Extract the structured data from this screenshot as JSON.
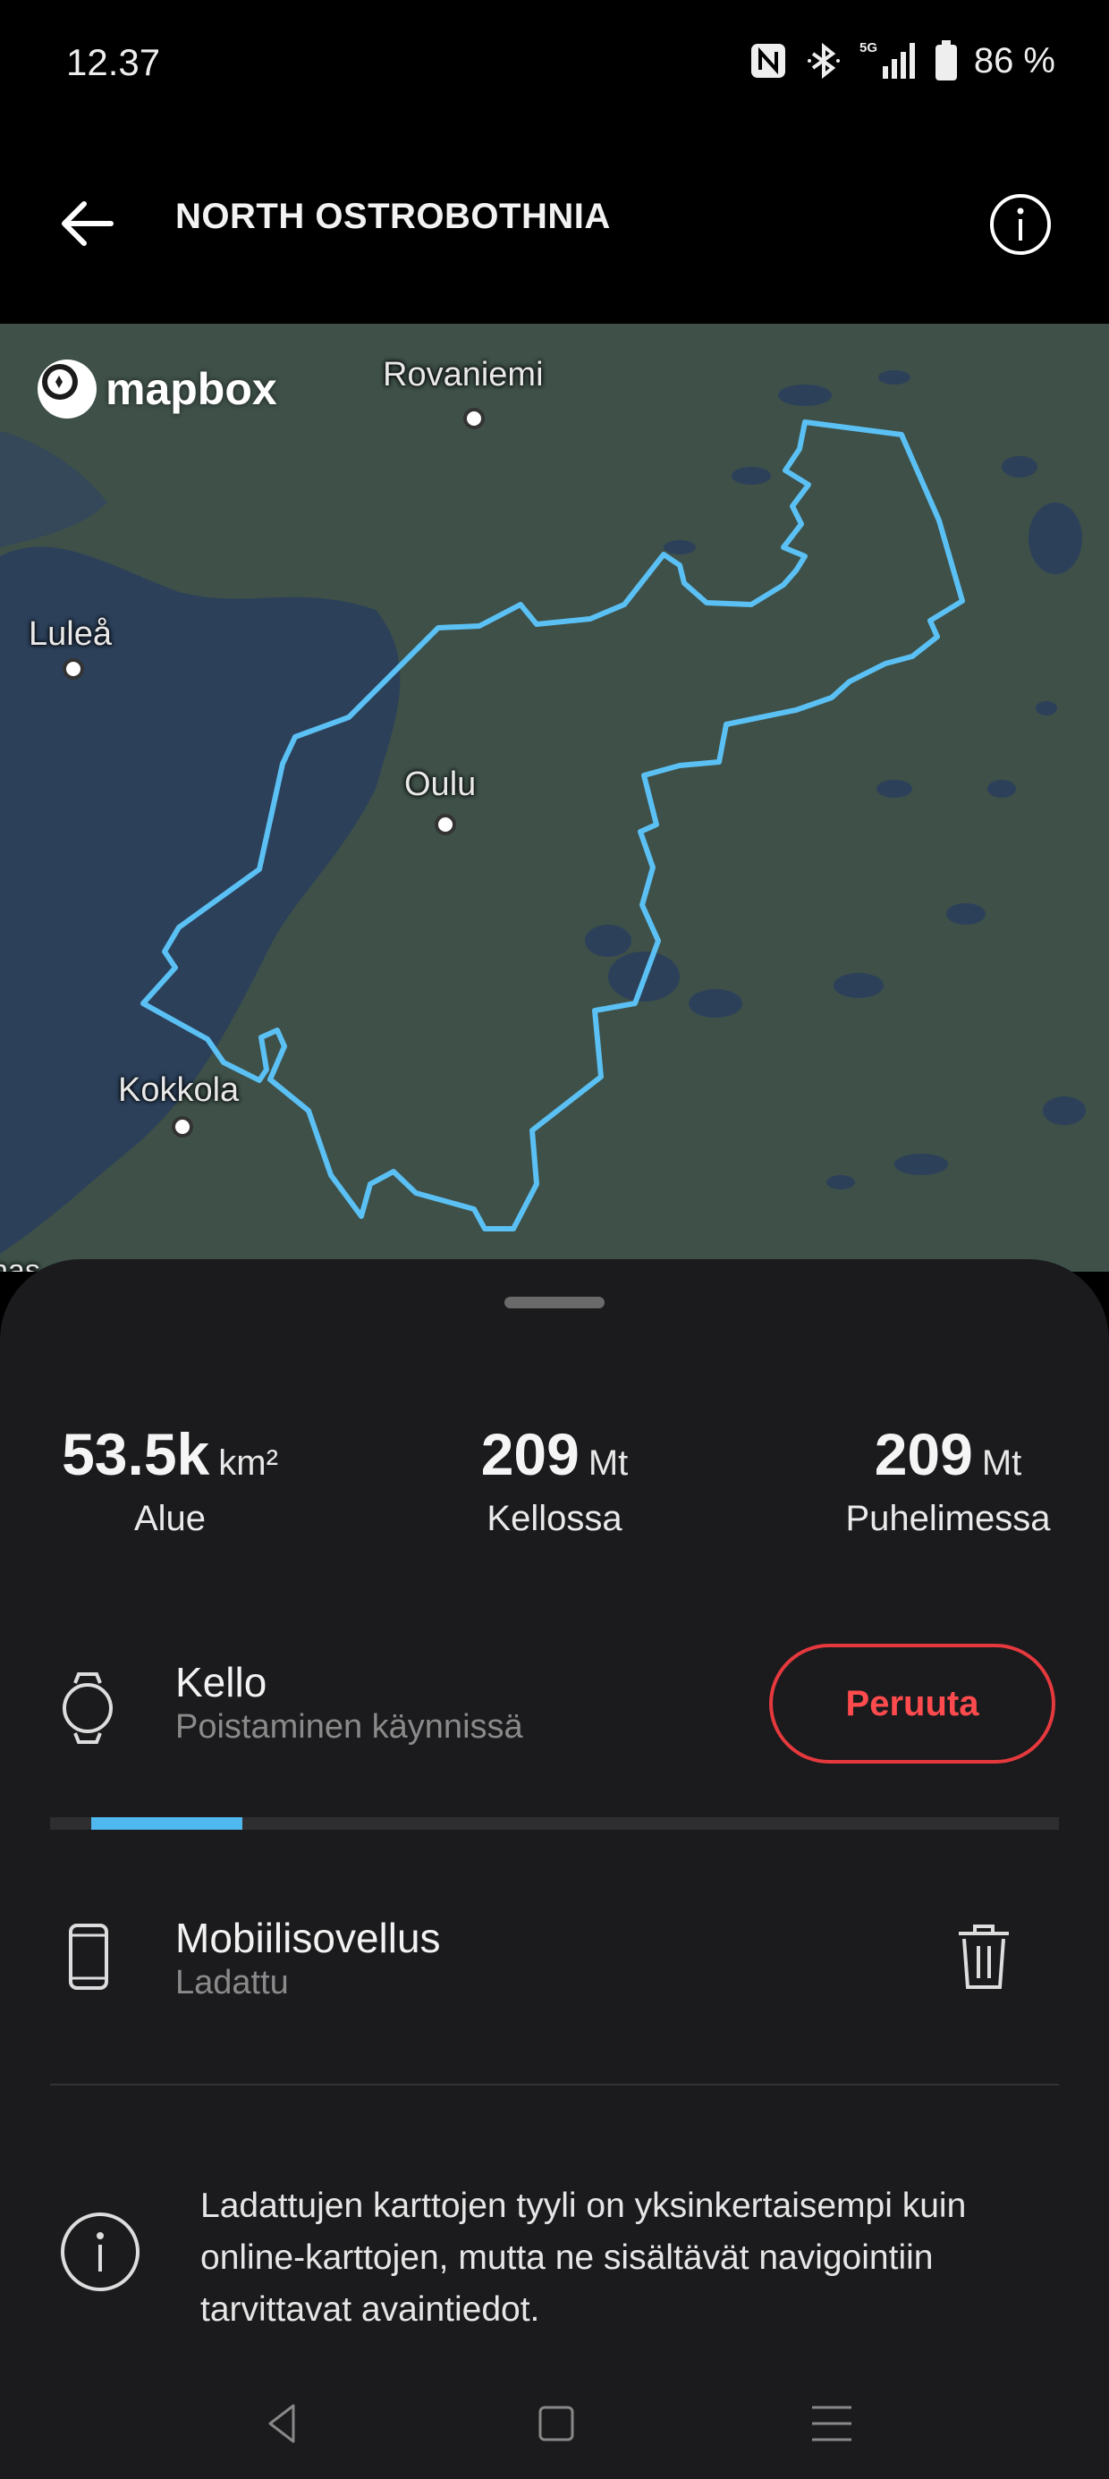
{
  "status_bar": {
    "time": "12.37",
    "network": "5G",
    "battery": "86 %",
    "icons": [
      "nfc-icon",
      "bluetooth-icon",
      "signal-icon",
      "battery-icon"
    ]
  },
  "app_bar": {
    "title": "NORTH OSTROBOTHNIA",
    "back_icon": "arrow-left-icon",
    "info_icon": "info-circle-icon"
  },
  "map": {
    "attribution": "mapbox",
    "cities": [
      "Rovaniemi",
      "Luleå",
      "Oulu",
      "Kokkola"
    ],
    "edge_label": "nas",
    "region_outline_color": "#5bc0f4",
    "water_color": "#2c405a",
    "land_color": "#3e5048"
  },
  "stats": [
    {
      "value": "53.5k",
      "unit": "km²",
      "label": "Alue"
    },
    {
      "value": "209",
      "unit": "Mt",
      "label": "Kellossa"
    },
    {
      "value": "209",
      "unit": "Mt",
      "label": "Puhelimessa"
    }
  ],
  "watch_row": {
    "title": "Kello",
    "subtitle": "Poistaminen käynnissä",
    "action": "Peruuta",
    "icon": "watch-icon",
    "progress": 0.15
  },
  "phone_row": {
    "title": "Mobiilisovellus",
    "subtitle": "Ladattu",
    "icon": "phone-icon",
    "action_icon": "trash-icon"
  },
  "info_note": {
    "text": "Ladattujen karttojen tyyli on yksinkertaisempi kuin online-karttojen, mutta ne sisältävät navigointiin tarvittavat avaintiedot."
  },
  "colors": {
    "accent": "#4fb8ee",
    "danger": "#e5393e",
    "sheet": "#1b1b1d"
  }
}
